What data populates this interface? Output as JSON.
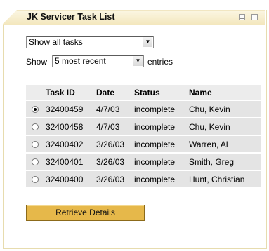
{
  "window": {
    "title": "JK Servicer Task List"
  },
  "filter": {
    "selected": "Show all tasks"
  },
  "show": {
    "prefix": "Show",
    "selected": "5 most recent",
    "suffix": "entries"
  },
  "table": {
    "headers": [
      "Task ID",
      "Date",
      "Status",
      "Name"
    ],
    "rows": [
      {
        "selected": true,
        "task_id": "32400459",
        "date": "4/7/03",
        "status": "incomplete",
        "name": "Chu, Kevin"
      },
      {
        "selected": false,
        "task_id": "32400458",
        "date": "4/7/03",
        "status": "incomplete",
        "name": "Chu, Kevin"
      },
      {
        "selected": false,
        "task_id": "32400402",
        "date": "3/26/03",
        "status": "incomplete",
        "name": "Warren, Al"
      },
      {
        "selected": false,
        "task_id": "32400401",
        "date": "3/26/03",
        "status": "incomplete",
        "name": "Smith, Greg"
      },
      {
        "selected": false,
        "task_id": "32400400",
        "date": "3/26/03",
        "status": "incomplete",
        "name": "Hunt, Christian"
      }
    ]
  },
  "actions": {
    "retrieve_label": "Retrieve Details"
  },
  "colors": {
    "title_bar": "#f3e7bd",
    "button": "#e6b84a",
    "row": "#e4e4e4"
  }
}
